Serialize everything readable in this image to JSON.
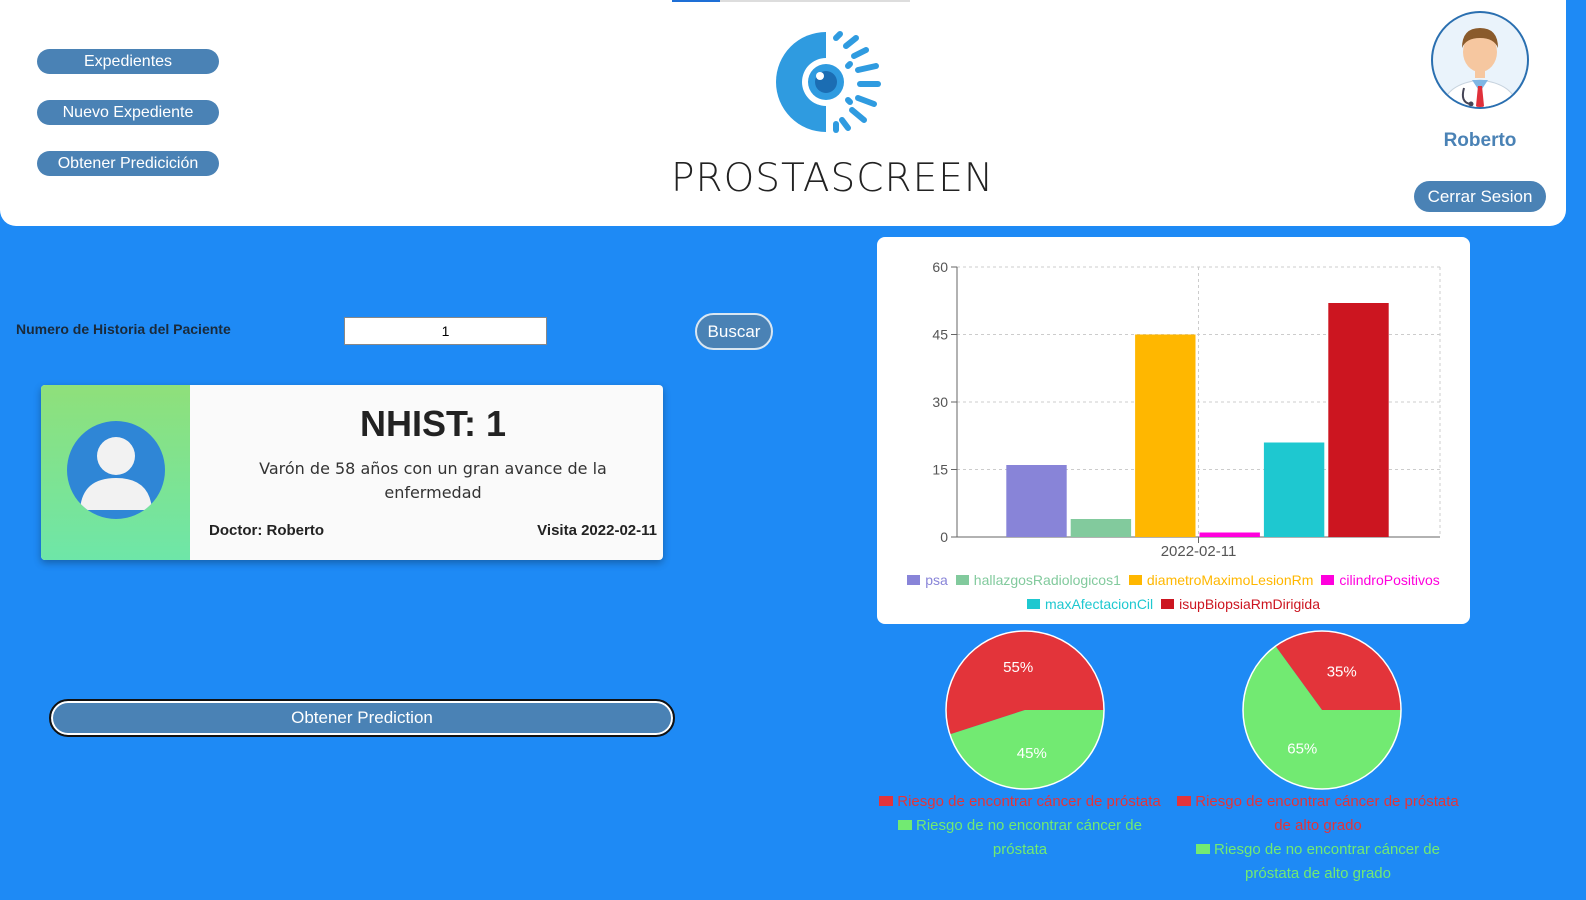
{
  "nav": {
    "expedientes": "Expedientes",
    "nuevo_expediente": "Nuevo Expediente",
    "obtener_prediccion": "Obtener Predicición"
  },
  "brand": {
    "name": "PROSTASCREEN"
  },
  "user": {
    "name": "Roberto",
    "logout_label": "Cerrar Sesion"
  },
  "search": {
    "label": "Numero de Historia del Paciente",
    "value": "1",
    "button_label": "Buscar"
  },
  "patient_card": {
    "title": "NHIST: 1",
    "description": "Varón de 58 años con un gran avance de la enfermedad",
    "doctor": "Doctor: Roberto",
    "visit": "Visita 2022-02-11"
  },
  "predict_button": {
    "label": "Obtener Prediction"
  },
  "chart_data": [
    {
      "type": "bar",
      "categories": [
        "2022-02-11"
      ],
      "series": [
        {
          "name": "psa",
          "values": [
            16
          ],
          "color": "#8884d8"
        },
        {
          "name": "hallazgosRadiologicos1",
          "values": [
            4
          ],
          "color": "#82ca9d"
        },
        {
          "name": "diametroMaximoLesionRm",
          "values": [
            45
          ],
          "color": "#ffb700"
        },
        {
          "name": "cilindroPositivos",
          "values": [
            1
          ],
          "color": "#ff00dd"
        },
        {
          "name": "maxAfectacionCil",
          "values": [
            21
          ],
          "color": "#1ec8d0"
        },
        {
          "name": "isupBiopsiaRmDirigida",
          "values": [
            52
          ],
          "color": "#cc1520"
        }
      ],
      "ylim": [
        0,
        60
      ],
      "yticks": [
        0,
        15,
        30,
        45,
        60
      ],
      "grid": true,
      "legend": "bottom"
    },
    {
      "type": "pie",
      "slices": [
        {
          "label": "Riesgo de encontrar cáncer de próstata",
          "value": 55,
          "display": "55%",
          "color": "#e3343a"
        },
        {
          "label": "Riesgo de no encontrar cáncer de próstata",
          "value": 45,
          "display": "45%",
          "color": "#72ea72"
        }
      ],
      "legend": "bottom"
    },
    {
      "type": "pie",
      "slices": [
        {
          "label": "Riesgo de encontrar cáncer de próstata de alto grado",
          "value": 35,
          "display": "35%",
          "color": "#e3343a"
        },
        {
          "label": "Riesgo de no encontrar cáncer de próstata de alto grado",
          "value": 65,
          "display": "65%",
          "color": "#72ea72"
        }
      ],
      "legend": "bottom"
    }
  ]
}
